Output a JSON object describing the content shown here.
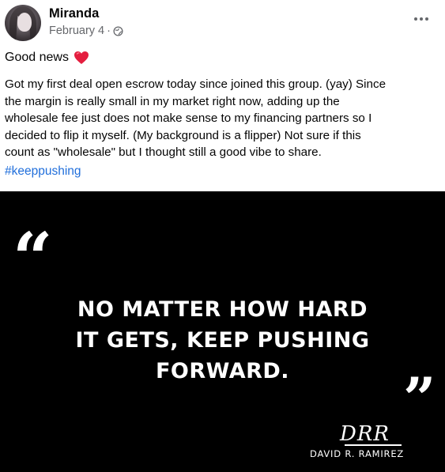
{
  "post": {
    "author": "Miranda",
    "date": "February 4",
    "separator": "·",
    "audience_icon": "globe-icon",
    "more_icon": "more-options-icon",
    "title": "Good news",
    "title_emoji": "red-heart-icon",
    "body_lines": [
      "Got my first deal open escrow today since joined this group. (yay) Since",
      "the margin is really small in my market right now, adding up the",
      "wholesale fee just does not make sense to my financing partners so I",
      "decided to flip it myself. (My background is a flipper) Not sure if this",
      "count as \"wholesale\" but I thought still a good vibe to share."
    ],
    "hashtag": "#keeppushing"
  },
  "image": {
    "open_quote": "“",
    "quote_lines": [
      "NO MATTER HOW HARD",
      "IT GETS, KEEP PUSHING",
      "FORWARD."
    ],
    "close_quote": "”",
    "logo": "DRR",
    "signature": "DAVID R. RAMIREZ"
  },
  "colors": {
    "link": "#216fdb",
    "secondary_text": "#65676b",
    "heart": "#e41e3f",
    "image_background": "#000000"
  }
}
